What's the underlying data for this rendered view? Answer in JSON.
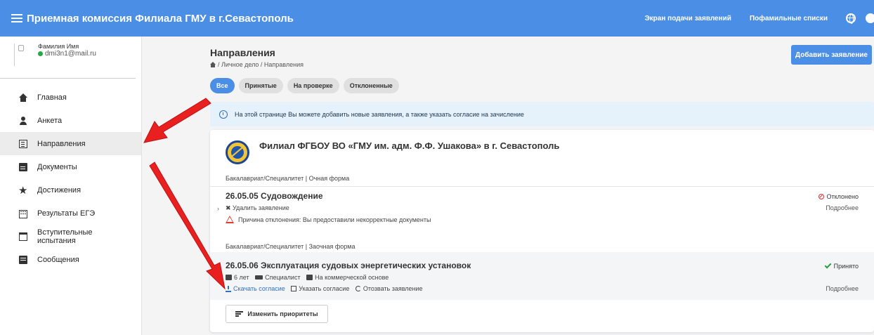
{
  "topbar": {
    "title": "Приемная комиссия Филиала ГМУ в г.Севастополь",
    "nav_apply": "Экран подачи заявлений",
    "nav_lists": "Пофамильные списки"
  },
  "user": {
    "name": "Фамилия Имя",
    "email": "dmi3n1@mail.ru"
  },
  "sidebar": {
    "items": [
      {
        "label": "Главная",
        "icon": "home-icon"
      },
      {
        "label": "Анкета",
        "icon": "person-icon"
      },
      {
        "label": "Направления",
        "icon": "list-icon"
      },
      {
        "label": "Документы",
        "icon": "document-icon"
      },
      {
        "label": "Достижения",
        "icon": "star-icon"
      },
      {
        "label": "Результаты ЕГЭ",
        "icon": "keyboard-icon"
      },
      {
        "label": "Вступительные испытания",
        "icon": "calendar-icon"
      },
      {
        "label": "Сообщения",
        "icon": "message-icon"
      }
    ]
  },
  "main": {
    "title": "Направления",
    "breadcrumb": "/ Личное дело  / Направления",
    "add_button": "Добавить заявление",
    "filters": [
      "Все",
      "Принятые",
      "На проверке",
      "Отклоненные"
    ],
    "info_text": "На этой странице Вы можете добавить новые заявления, а также указать согласие на зачисление",
    "university": "Филиал ФГБОУ ВО «ГМУ им. адм. Ф.Ф. Ушакова» в г. Севастополь",
    "section1": "Бакалавриат/Специалитет | Очная форма",
    "app1": {
      "title": "26.05.05 Судовождение",
      "delete": "✖ Удалить заявление",
      "reason": "Причина отклонения: Вы предоставили некорректные документы",
      "status": "Отклонено",
      "more": "Подробнее"
    },
    "section2": "Бакалавриат/Специалитет | Заочная форма",
    "app2": {
      "title": "26.05.06 Эксплуатация судовых энергетических установок",
      "duration": "6 лет",
      "level": "Специалист",
      "basis": "На коммерческой основе",
      "download": "Скачать согласие",
      "consent": "Указать согласие",
      "revoke": "Отозвать заявление",
      "status": "Принято",
      "more": "Подробнее"
    },
    "priorities_button": "Изменить приоритеты"
  },
  "colors": {
    "primary": "#4b8ee6",
    "reject": "#d32f2f",
    "accept": "#2e9e40",
    "arrow": "#e82020"
  }
}
